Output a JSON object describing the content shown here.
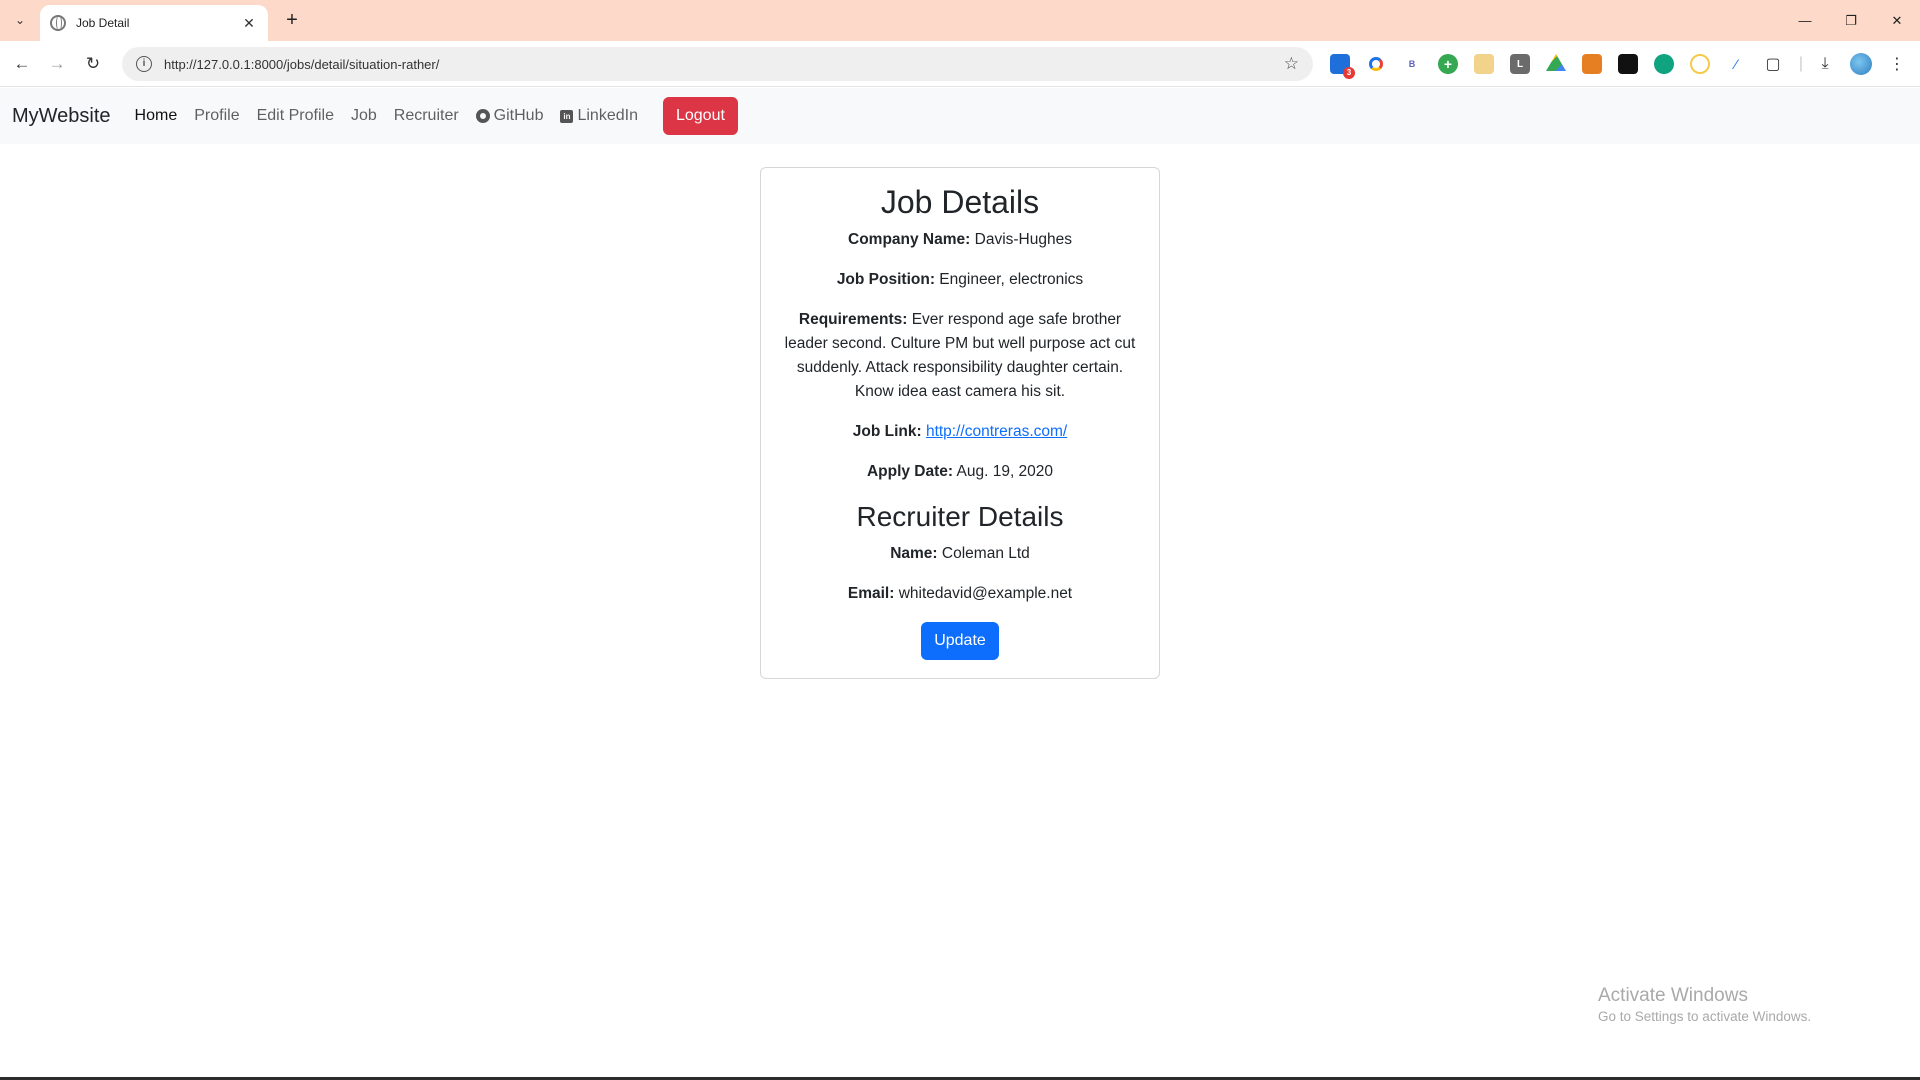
{
  "browser": {
    "tab_title": "Job Detail",
    "url": "http://127.0.0.1:8000/jobs/detail/situation-rather/",
    "extension_badge": "3",
    "extensions": [
      {
        "name": "trello-extension-icon",
        "color": "#1e6fd9",
        "label": ""
      },
      {
        "name": "circle-extension-icon",
        "color": "#ffffff",
        "label": ""
      },
      {
        "name": "b-extension-icon",
        "color": "#ffffff",
        "label": "B"
      },
      {
        "name": "plus-extension-icon",
        "color": "#36a852",
        "label": "+"
      },
      {
        "name": "chart-extension-icon",
        "color": "#f3d38b",
        "label": ""
      },
      {
        "name": "l-extension-icon",
        "color": "#6b6b6b",
        "label": "L"
      },
      {
        "name": "drive-extension-icon",
        "color": "#ffffff",
        "label": ""
      },
      {
        "name": "orange-extension-icon",
        "color": "#e67e22",
        "label": ""
      },
      {
        "name": "black-extension-icon",
        "color": "#111111",
        "label": ""
      },
      {
        "name": "openai-extension-icon",
        "color": "#10a37f",
        "label": ""
      },
      {
        "name": "face-extension-icon",
        "color": "#f7c948",
        "label": ""
      },
      {
        "name": "pen-extension-icon",
        "color": "#ffffff",
        "label": ""
      }
    ]
  },
  "navbar": {
    "brand": "MyWebsite",
    "links": {
      "home": "Home",
      "profile": "Profile",
      "edit_profile": "Edit Profile",
      "job": "Job",
      "recruiter": "Recruiter",
      "github": "GitHub",
      "linkedin": "LinkedIn"
    },
    "logout": "Logout"
  },
  "job": {
    "heading": "Job Details",
    "company_label": "Company Name:",
    "company": "Davis-Hughes",
    "position_label": "Job Position:",
    "position": "Engineer, electronics",
    "requirements_label": "Requirements:",
    "requirements": "Ever respond age safe brother leader second. Culture PM but well purpose act cut suddenly. Attack responsibility daughter certain. Know idea east camera his sit.",
    "link_label": "Job Link:",
    "link": "http://contreras.com/",
    "apply_label": "Apply Date:",
    "apply_date": "Aug. 19, 2020"
  },
  "recruiter": {
    "heading": "Recruiter Details",
    "name_label": "Name:",
    "name": "Coleman Ltd",
    "email_label": "Email:",
    "email": "whitedavid@example.net"
  },
  "actions": {
    "update": "Update"
  },
  "watermark": {
    "title": "Activate Windows",
    "subtitle": "Go to Settings to activate Windows."
  }
}
